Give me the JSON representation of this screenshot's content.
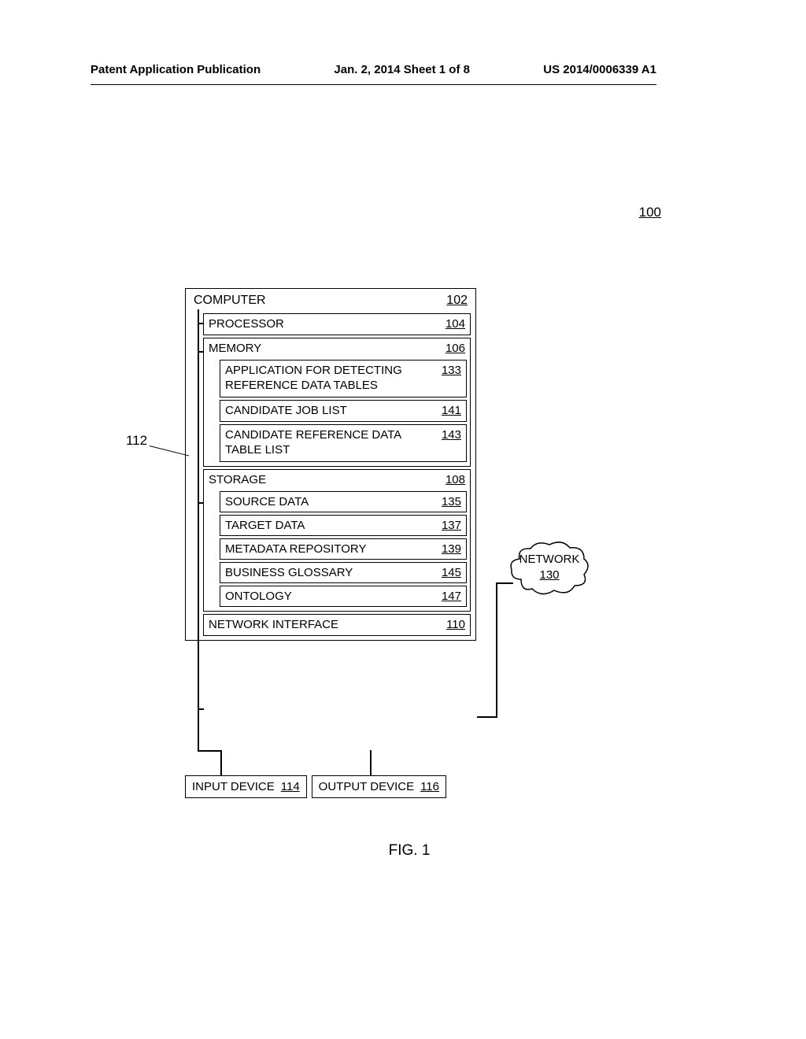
{
  "header": {
    "left": "Patent Application Publication",
    "center": "Jan. 2, 2014  Sheet 1 of 8",
    "right": "US 2014/0006339 A1"
  },
  "diagram": {
    "system_ref": "100",
    "bus_ref": "112",
    "computer": {
      "label": "COMPUTER",
      "ref": "102",
      "processor": {
        "label": "PROCESSOR",
        "ref": "104"
      },
      "memory": {
        "label": "MEMORY",
        "ref": "106",
        "items": [
          {
            "label": "APPLICATION FOR DETECTING REFERENCE DATA TABLES",
            "ref": "133"
          },
          {
            "label": "CANDIDATE JOB LIST",
            "ref": "141"
          },
          {
            "label": "CANDIDATE REFERENCE DATA TABLE LIST",
            "ref": "143"
          }
        ]
      },
      "storage": {
        "label": "STORAGE",
        "ref": "108",
        "items": [
          {
            "label": "SOURCE DATA",
            "ref": "135"
          },
          {
            "label": "TARGET DATA",
            "ref": "137"
          },
          {
            "label": "METADATA REPOSITORY",
            "ref": "139"
          },
          {
            "label": "BUSINESS GLOSSARY",
            "ref": "145"
          },
          {
            "label": "ONTOLOGY",
            "ref": "147"
          }
        ]
      },
      "network_interface": {
        "label": "NETWORK INTERFACE",
        "ref": "110"
      }
    },
    "input_device": {
      "label": "INPUT DEVICE",
      "ref": "114"
    },
    "output_device": {
      "label": "OUTPUT DEVICE",
      "ref": "116"
    },
    "network": {
      "label": "NETWORK",
      "ref": "130"
    },
    "figure_caption": "FIG. 1"
  }
}
